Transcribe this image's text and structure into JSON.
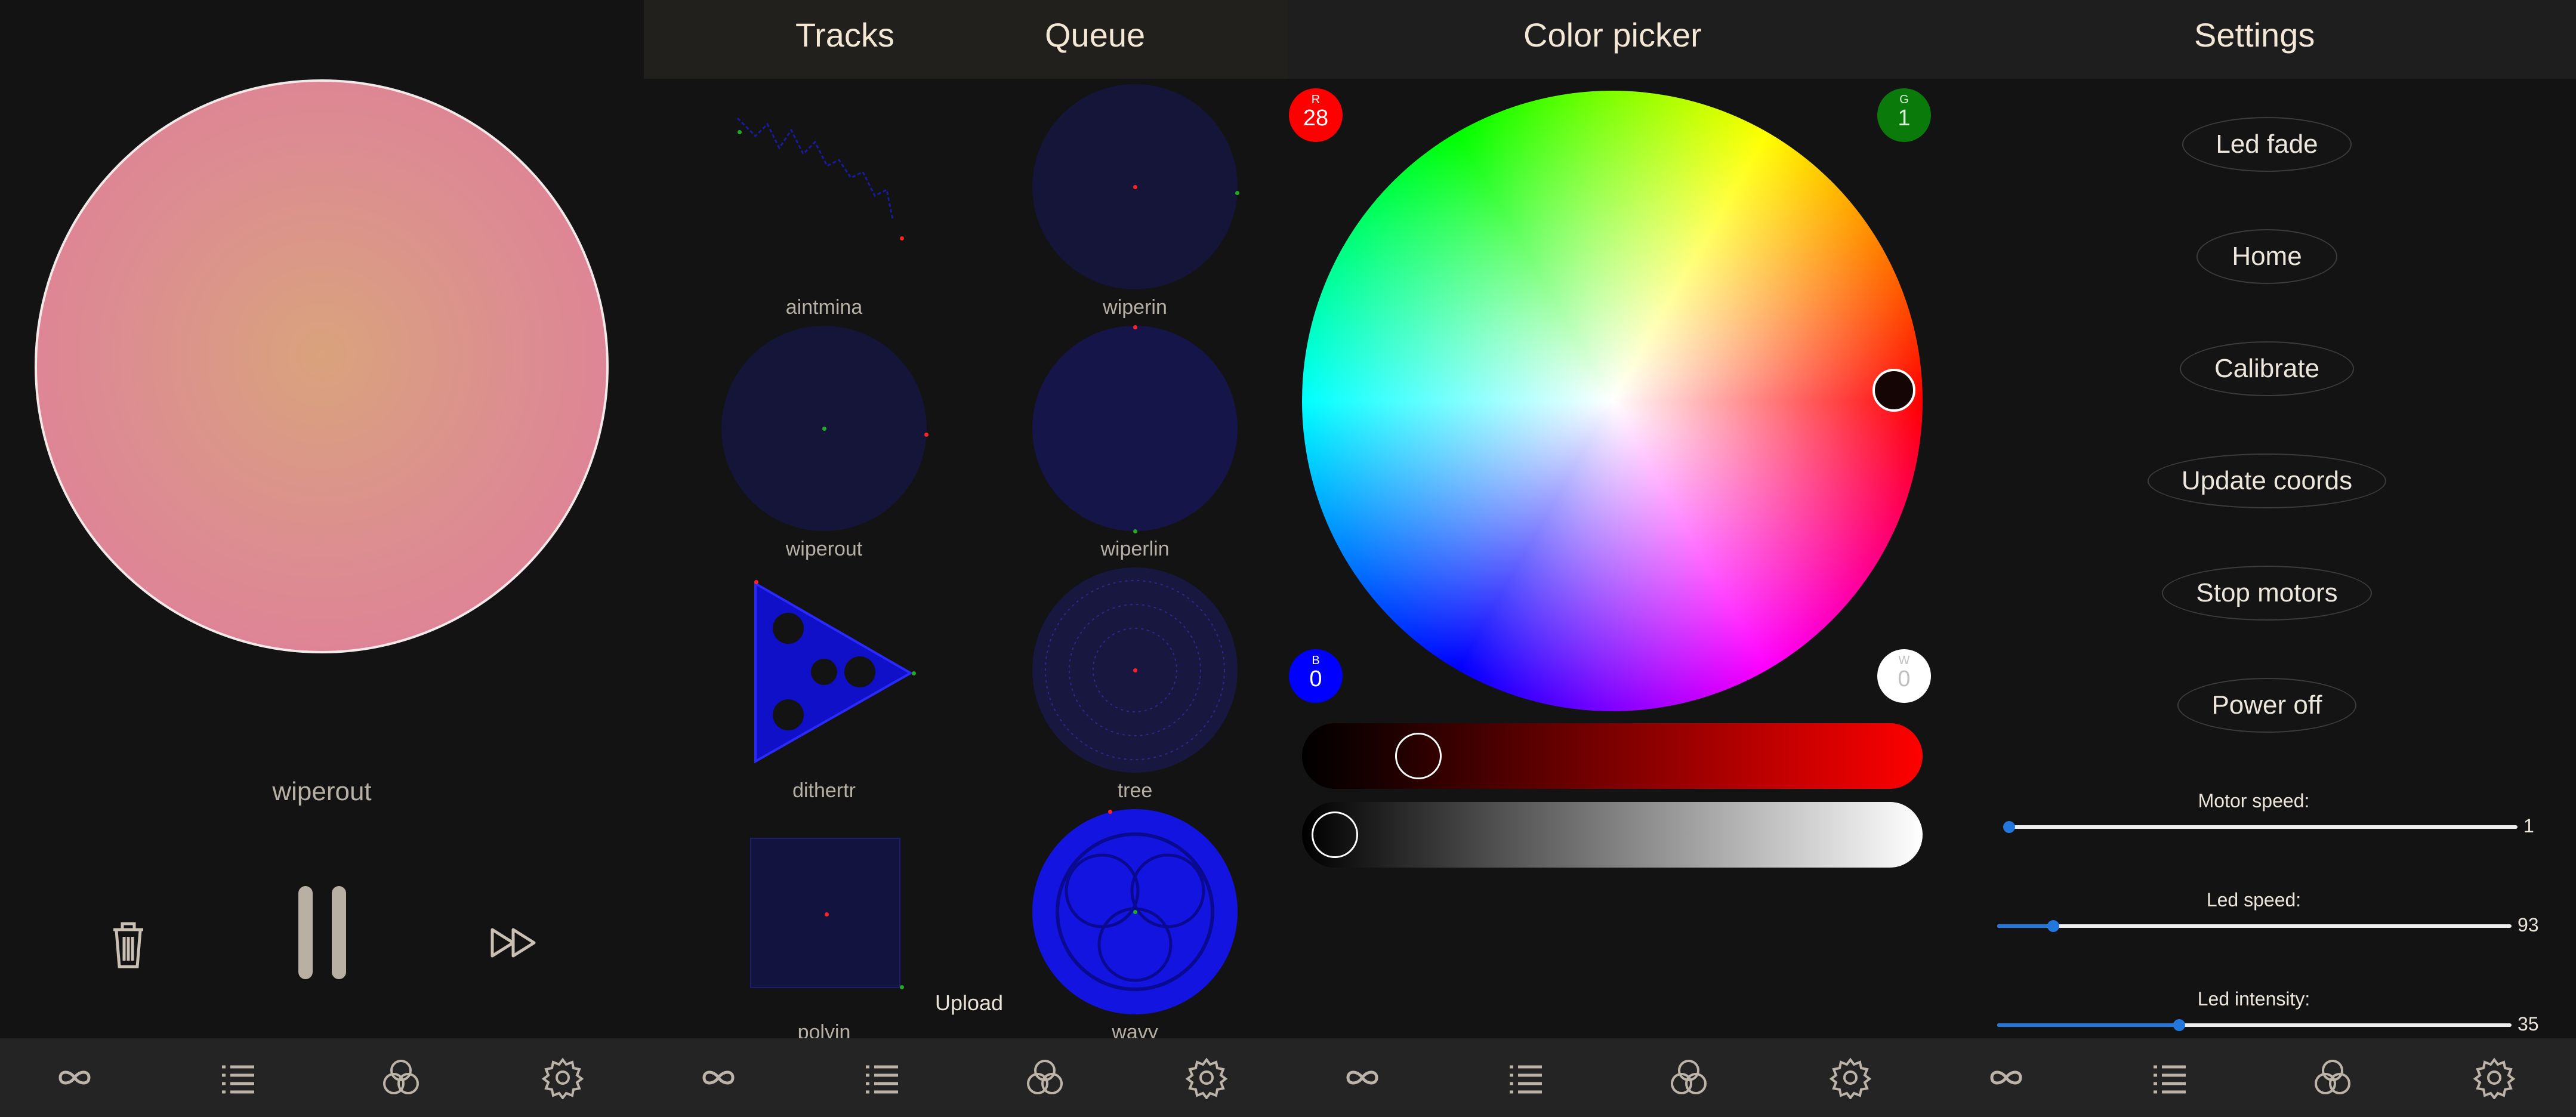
{
  "player": {
    "now_playing": "wiperout",
    "controls": {
      "delete_icon": "trash-icon",
      "pause_icon": "pause-icon",
      "skip_icon": "fast-forward-icon"
    },
    "sand_color": "#de8a96"
  },
  "tracks_screen": {
    "tabs": [
      "Tracks",
      "Queue"
    ],
    "tracks": [
      "aintmina",
      "wiperin",
      "wiperout",
      "wiperlin",
      "dithertr",
      "tree",
      "polyin",
      "wavy"
    ],
    "upload_label": "Upload"
  },
  "color_screen": {
    "title": "Color picker",
    "channels": {
      "r": {
        "label": "R",
        "value": "28",
        "color": "#ff0000"
      },
      "g": {
        "label": "G",
        "value": "1",
        "color": "#0a7a0a"
      },
      "b": {
        "label": "B",
        "value": "0",
        "color": "#0000ff"
      },
      "w": {
        "label": "W",
        "value": "0",
        "color": "#ffffff"
      }
    },
    "red_slider_level": 0.15,
    "white_slider_level": 0.0
  },
  "settings_screen": {
    "title": "Settings",
    "buttons": [
      "Led fade",
      "Home",
      "Calibrate",
      "Update coords",
      "Stop motors",
      "Power off"
    ],
    "motor_speed": {
      "label": "Motor speed:",
      "value": "1",
      "level": 0.0
    },
    "led_speed": {
      "label": "Led speed:",
      "value": "93",
      "level": 0.1
    },
    "led_intensity": {
      "label": "Led intensity:",
      "value": "35",
      "level": 0.35
    }
  },
  "nav": {
    "icons": [
      "infinity-icon",
      "list-icon",
      "color-circles-icon",
      "gear-icon"
    ]
  },
  "colors": {
    "background": "#131313",
    "topbar": "#1e1e1e",
    "text": "#f1e6d2",
    "accent": "#2277dd",
    "track_blue": "#1a1aff"
  }
}
